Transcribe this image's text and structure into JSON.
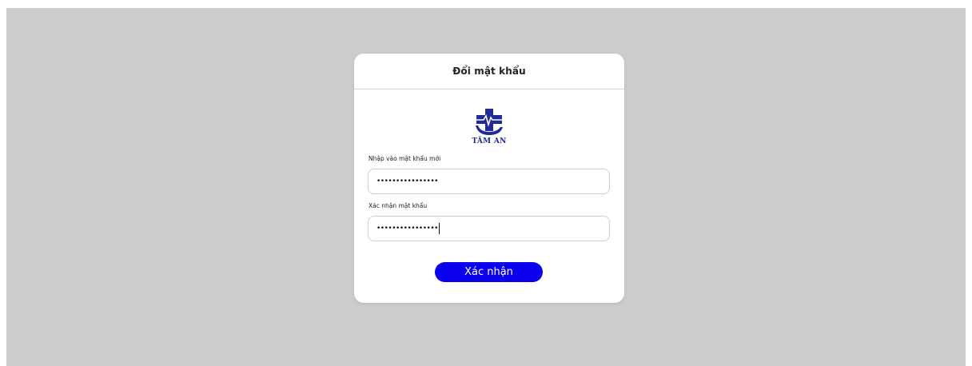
{
  "dialog": {
    "title": "Đổi mật khẩu",
    "logo_text": "TÂM AN",
    "new_password_label": "Nhập vào mật khẩu mới",
    "new_password_value": "••••••••••••••••",
    "confirm_password_label": "Xác nhận mật khẩu",
    "confirm_password_value": "••••••••••••••••",
    "submit_label": "Xác nhận"
  },
  "colors": {
    "backdrop": "#cccccc",
    "primary_button": "#0a00ee",
    "logo_blue": "#1f2a9c"
  },
  "icons": {
    "logo": "medical-cross-heartbeat-hand-logo"
  }
}
